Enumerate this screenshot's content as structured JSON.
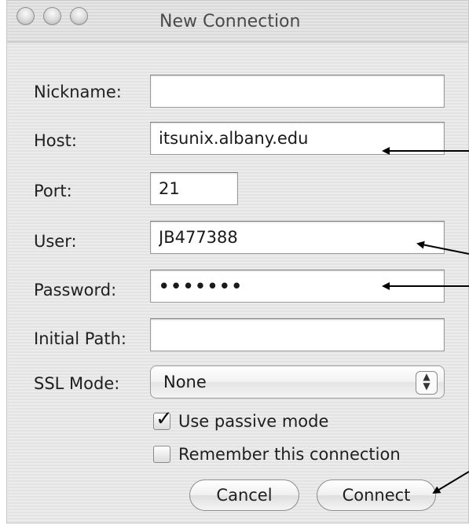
{
  "window": {
    "title": "New Connection"
  },
  "form": {
    "nickname": {
      "label": "Nickname:",
      "value": ""
    },
    "host": {
      "label": "Host:",
      "value": "itsunix.albany.edu"
    },
    "port": {
      "label": "Port:",
      "value": "21"
    },
    "user": {
      "label": "User:",
      "value": "JB477388"
    },
    "password": {
      "label": "Password:",
      "value": "•••••••"
    },
    "initial_path": {
      "label": "Initial Path:",
      "value": ""
    },
    "ssl_mode": {
      "label": "SSL Mode:",
      "value": "None"
    }
  },
  "options": {
    "passive_mode": {
      "label": "Use passive mode",
      "checked": true
    },
    "remember": {
      "label": "Remember this connection",
      "checked": false
    }
  },
  "buttons": {
    "cancel": "Cancel",
    "connect": "Connect"
  },
  "icons": {
    "stepper": "up-down-arrows-icon",
    "annotation_arrow": "black-arrow-icon"
  }
}
